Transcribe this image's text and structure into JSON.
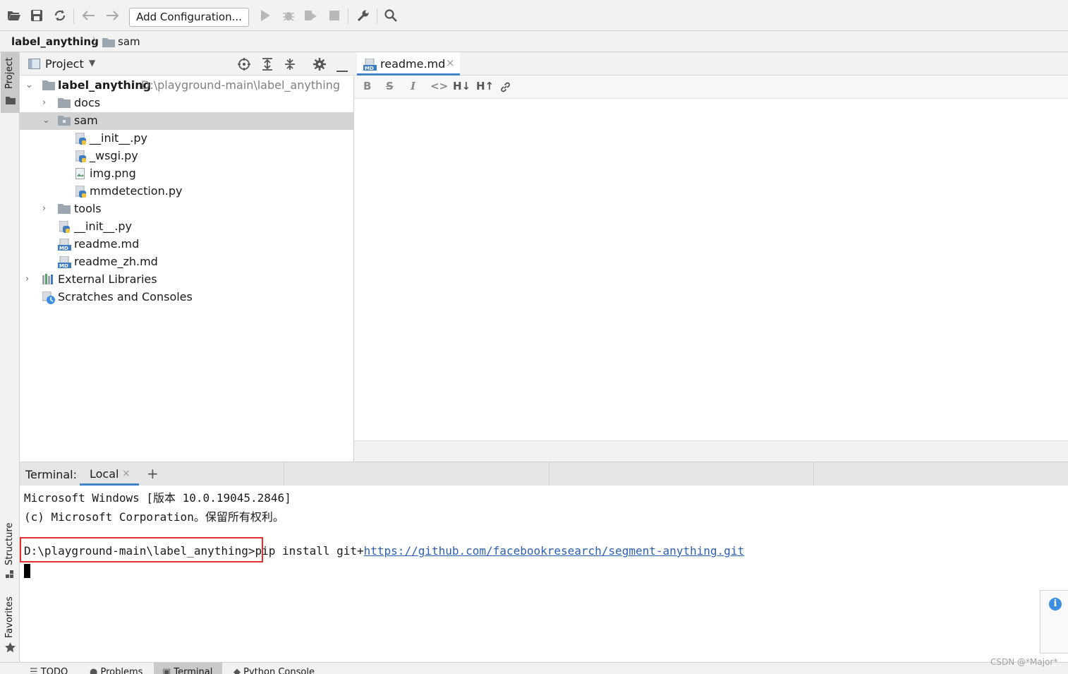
{
  "toolbar": {
    "add_configuration_label": "Add Configuration...",
    "icons": [
      "open-folder-icon",
      "save-icon",
      "sync-icon",
      "back-arrow-icon",
      "forward-arrow-icon",
      "run-icon",
      "debug-icon",
      "coverage-icon",
      "stop-icon",
      "wrench-icon",
      "search-icon"
    ]
  },
  "breadcrumb": {
    "root": "label_anything",
    "child": "sam"
  },
  "left_strip": {
    "project_label": "Project",
    "structure_label": "Structure",
    "favorites_label": "Favorites"
  },
  "project_panel": {
    "title": "Project",
    "tree": [
      {
        "label": "label_anything",
        "path": "D:\\playground-main\\label_anything",
        "type": "folder",
        "expanded": true
      },
      {
        "label": "docs",
        "type": "folder",
        "expanded": false
      },
      {
        "label": "sam",
        "type": "folder",
        "expanded": true,
        "selected": true
      },
      {
        "label": "__init__.py",
        "type": "python"
      },
      {
        "label": "_wsgi.py",
        "type": "python"
      },
      {
        "label": "img.png",
        "type": "image"
      },
      {
        "label": "mmdetection.py",
        "type": "python"
      },
      {
        "label": "tools",
        "type": "folder",
        "expanded": false
      },
      {
        "label": "__init__.py",
        "type": "python"
      },
      {
        "label": "readme.md",
        "type": "markdown"
      },
      {
        "label": "readme_zh.md",
        "type": "markdown"
      },
      {
        "label": "External Libraries",
        "type": "libraries",
        "expanded": false
      },
      {
        "label": "Scratches and Consoles",
        "type": "scratches"
      }
    ]
  },
  "editor": {
    "tab_label": "readme.md",
    "md_toolbar": [
      "B",
      "S",
      "I",
      "<>",
      "H↓",
      "H↑",
      "link"
    ]
  },
  "terminal": {
    "label": "Terminal:",
    "tab_label": "Local",
    "lines": [
      "Microsoft Windows [版本 10.0.19045.2846]",
      "(c) Microsoft Corporation。保留所有权利。"
    ],
    "prompt": "D:\\playground-main\\label_anything>",
    "command_prefix": "pip install git+",
    "command_link": "https://github.com/facebookresearch/segment-anything.git"
  },
  "bottom_bar": {
    "items": [
      "TODO",
      "Problems",
      "Terminal",
      "Python Console"
    ]
  },
  "watermark": "CSDN @*Major*",
  "colors": {
    "accent": "#4083c9",
    "highlight_box": "#e03030",
    "link": "#2a5fb3",
    "info": "#3c8ee0"
  }
}
